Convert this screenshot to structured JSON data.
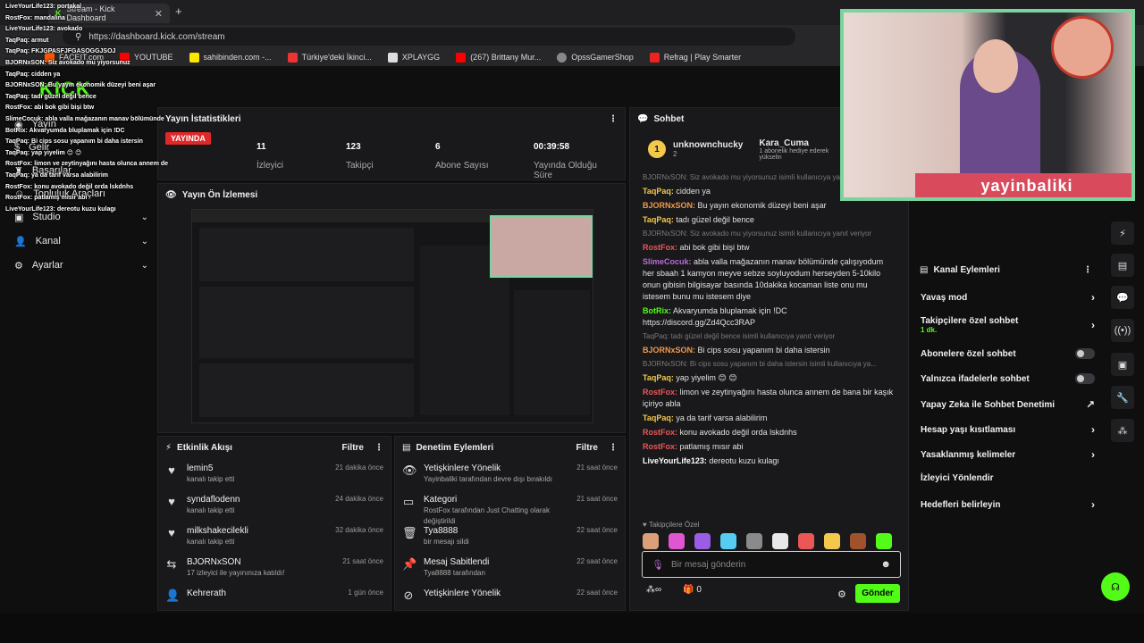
{
  "browser": {
    "tab_title": "Stream - Kick Dashboard",
    "url": "https://dashboard.kick.com/stream",
    "bookmarks": [
      "FACEIT.com",
      "YOUTUBE",
      "sahibinden.com -...",
      "Türkiye'deki İkinci...",
      "XPLAYGG",
      "(267) Brittany Mur...",
      "OpssGamerShop",
      "Refrag | Play Smarter"
    ]
  },
  "sidebar": {
    "logo": "KICK",
    "items": [
      {
        "label": "Yayın"
      },
      {
        "label": "Gelir"
      },
      {
        "label": "Başarılar"
      },
      {
        "label": "Topluluk Araçları"
      },
      {
        "label": "Studio"
      },
      {
        "label": "Kanal"
      },
      {
        "label": "Ayarlar"
      }
    ]
  },
  "stream_info": {
    "title": "Yayın İstatistikleri",
    "live_badge": "YAYINDA",
    "stats": [
      {
        "value": "11",
        "label": "İzleyici"
      },
      {
        "value": "123",
        "label": "Takipçi"
      },
      {
        "value": "6",
        "label": "Abone Sayısı"
      },
      {
        "value": "00:39:58",
        "label": "Yayında Olduğu Süre"
      }
    ]
  },
  "preview": {
    "title": "Yayın Ön İzlemesi"
  },
  "activity": {
    "title": "Etkinlik Akışı",
    "filter": "Filtre",
    "rows": [
      {
        "name": "lemin5",
        "desc": "kanalı takip etti",
        "time": "21 dakika önce"
      },
      {
        "name": "syndaflodenn",
        "desc": "kanalı takip etti",
        "time": "24 dakika önce"
      },
      {
        "name": "milkshakecilekli",
        "desc": "kanalı takip etti",
        "time": "32 dakika önce"
      },
      {
        "name": "BJORNxSON",
        "desc": "17 izleyici ile yayınınıza katıldı!",
        "time": "21 saat önce"
      },
      {
        "name": "Kehrerath",
        "desc": "",
        "time": "1 gün önce"
      }
    ]
  },
  "moderation": {
    "title": "Denetim Eylemleri",
    "filter": "Filtre",
    "rows": [
      {
        "name": "Yetişkinlere Yönelik",
        "desc": "Yayinbaliki tarafından devre dışı bırakıldı",
        "time": "21 saat önce"
      },
      {
        "name": "Kategori",
        "desc": "RostFox tarafından Just Chatting olarak değiştirildi",
        "time": "21 saat önce"
      },
      {
        "name": "Tya8888",
        "desc": "bir mesajı sildi",
        "time": "22 saat önce"
      },
      {
        "name": "Mesaj Sabitlendi",
        "desc": "Tya8888 tarafından",
        "time": "22 saat önce"
      },
      {
        "name": "Yetişkinlere Yönelik",
        "desc": "",
        "time": "22 saat önce"
      }
    ]
  },
  "chat": {
    "title": "Sohbet",
    "pinned_user": "unknownchucky",
    "pinned_count": "2",
    "gift_user": "Kara_Cuma",
    "gift_text": "1 abonelik hediye ederek yükselin",
    "messages": [
      {
        "type": "reply",
        "text": "BJORNxSON: Siz avokado mu yiyorsunuz isimli kullanıcıya yanıt veriyor"
      },
      {
        "type": "msg",
        "user": "TaqPaq:",
        "color": "#f2c94c",
        "text": "cidden ya"
      },
      {
        "type": "msg",
        "user": "BJORNxSON:",
        "color": "#f2994a",
        "text": "Bu yayın ekonomik düzeyi beni aşar"
      },
      {
        "type": "msg",
        "user": "TaqPaq:",
        "color": "#f2c94c",
        "text": "tadı güzel değil bence"
      },
      {
        "type": "reply",
        "text": "BJORNxSON: Siz avokado mu yiyorsunuz isimli kullanıcıya yanıt veriyor"
      },
      {
        "type": "msg",
        "user": "RostFox:",
        "color": "#eb5757",
        "text": "abi bok gibi bişi btw"
      },
      {
        "type": "msg",
        "user": "SlimeCocuk:",
        "color": "#bb6bd9",
        "text": "abla valla mağazanın manav bölümünde çalışıyodum her sbaah 1 kamyon meyve sebze soyluyodum herseyden 5-10kilo onun gibisin bilgisayar basında 10dakika kocaman liste onu mu istesem bunu mu istesem diye"
      },
      {
        "type": "msg",
        "user": "BotRix:",
        "color": "#53fc18",
        "text": "Akvaryumda bluplamak için !DC https://discord.gg/Zd4Qcc3RAP"
      },
      {
        "type": "reply",
        "text": "TaqPaq: tadı güzel değil bence isimli kullanıcıya yanıt veriyor"
      },
      {
        "type": "msg",
        "user": "BJORNxSON:",
        "color": "#f2994a",
        "text": "Bi cips sosu yapanım bi daha istersin"
      },
      {
        "type": "reply",
        "text": "BJORNxSON: Bi cips sosu yapanım bi daha istersin isimli kullanıcıya ya..."
      },
      {
        "type": "msg",
        "user": "TaqPaq:",
        "color": "#f2c94c",
        "text": "yap yiyelim 😊 😊"
      },
      {
        "type": "msg",
        "user": "RostFox:",
        "color": "#eb5757",
        "text": "limon ve zeytinyağını hasta olunca annem de bana bir kaşık içiriyo abla"
      },
      {
        "type": "msg",
        "user": "TaqPaq:",
        "color": "#f2c94c",
        "text": "ya da tarif varsa alabilirim"
      },
      {
        "type": "msg",
        "user": "RostFox:",
        "color": "#eb5757",
        "text": "konu avokado değil orda lskdnhs"
      },
      {
        "type": "msg",
        "user": "RostFox:",
        "color": "#eb5757",
        "text": "patlamış mısır abi"
      },
      {
        "type": "msg",
        "user": "LiveYourLife123:",
        "color": "#ffffff",
        "text": "dereotu kuzu kulagı"
      }
    ],
    "emote_section": "Takipçilere Özel",
    "input_placeholder": "Bir mesaj gönderin",
    "points": "0",
    "send_label": "Gönder"
  },
  "channel_actions": {
    "title": "Kanal Eylemleri",
    "items": [
      {
        "label": "Yavaş mod",
        "sub": "",
        "kind": "arrow"
      },
      {
        "label": "Takipçilere özel sohbet",
        "sub": "1 dk.",
        "kind": "arrow"
      },
      {
        "label": "Abonelere özel sohbet",
        "sub": "",
        "kind": "toggle"
      },
      {
        "label": "Yalnızca ifadelerle sohbet",
        "sub": "",
        "kind": "toggle"
      },
      {
        "label": "Yapay Zeka ile Sohbet Denetimi",
        "sub": "",
        "kind": "ext"
      },
      {
        "label": "Hesap yaşı kısıtlaması",
        "sub": "",
        "kind": "arrow"
      },
      {
        "label": "Yasaklanmış kelimeler",
        "sub": "",
        "kind": "arrow"
      },
      {
        "label": "İzleyici Yönlendir",
        "sub": "",
        "kind": "none"
      },
      {
        "label": "Hedefleri belirleyin",
        "sub": "",
        "kind": "arrow"
      }
    ]
  },
  "webcam": {
    "brand": "yayinbaliki"
  },
  "overlay_chat": [
    "LiveYourLife123: portakal",
    "RostFox: mandalina",
    "LiveYourLife123: avokado",
    "TaqPaq: armut",
    "TaqPaq: FKJGPASFJFGASOGGJSOJ",
    "BJORNxSON: Siz avokado mu yiyorsunuz",
    "TaqPaq: cidden ya",
    "BJORNxSON: Bu yayın ekonomik düzeyi beni aşar",
    "TaqPaq: tadı güzel değil bence",
    "RostFox: abi bok gibi bişi btw",
    "SlimeCocuk: abla valla mağazanın manav bölümünde",
    "BotRix: Akvaryumda bluplamak için !DC",
    "TaqPaq: Bi cips sosu yapanım bi daha istersin",
    "TaqPaq: yap yiyelim 😊 😊",
    "RostFox: limon ve zeytinyağını hasta olunca annem de",
    "TaqPaq: ya da tarif varsa alabilirim",
    "RostFox: konu avokado değil orda lskdnhs",
    "RostFox: patlamış mısır abi",
    "LiveYourLife123: dereotu kuzu kulagı"
  ]
}
